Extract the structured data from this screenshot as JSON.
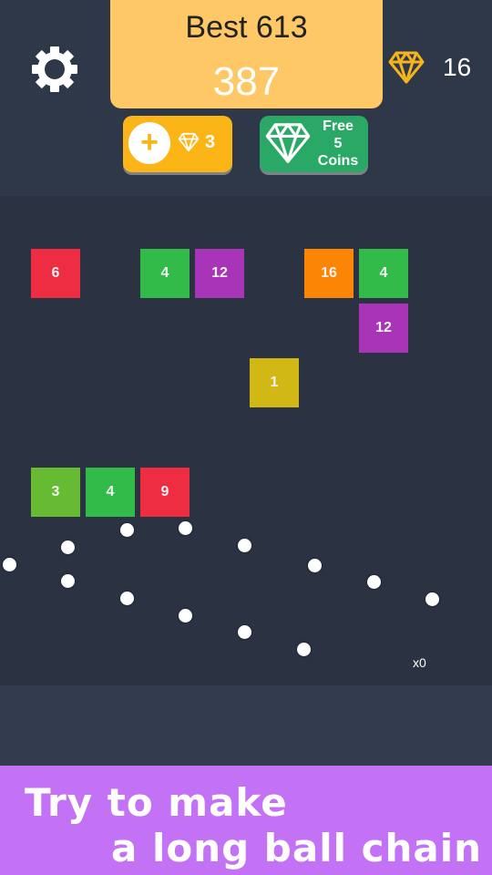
{
  "header": {
    "best_label": "Best 613",
    "score": "387",
    "gem_count": "16",
    "settings_icon": "gear-icon",
    "gem_icon": "diamond-icon"
  },
  "buttons": {
    "add_balls": {
      "icon": "plus-icon",
      "gem_icon": "diamond-icon",
      "cost": "3"
    },
    "free_coins": {
      "icon": "diamond-icon",
      "label_line1": "Free",
      "label_line2": "5",
      "label_line3": "Coins"
    }
  },
  "colors": {
    "score_card": "#fec866",
    "add_button": "#fbb516",
    "free_button": "#2aa865",
    "gem": "#f5b41d",
    "promo_banner": "#c372f5"
  },
  "board": {
    "blocks": [
      {
        "value": "6",
        "col": 0,
        "row": 0,
        "color": "#ee2d43"
      },
      {
        "value": "4",
        "col": 2,
        "row": 0,
        "color": "#33bb49"
      },
      {
        "value": "12",
        "col": 3,
        "row": 0,
        "color": "#a835b8"
      },
      {
        "value": "16",
        "col": 5,
        "row": 0,
        "color": "#fd8505"
      },
      {
        "value": "4",
        "col": 6,
        "row": 0,
        "color": "#33bb49"
      },
      {
        "value": "12",
        "col": 6,
        "row": 1,
        "color": "#a835b8"
      },
      {
        "value": "1",
        "col": 4,
        "row": 2,
        "color": "#d2b815"
      },
      {
        "value": "3",
        "col": 0,
        "row": 4,
        "color": "#66bb33"
      },
      {
        "value": "4",
        "col": 1,
        "row": 4,
        "color": "#33bb49"
      },
      {
        "value": "9",
        "col": 2,
        "row": 4,
        "color": "#ee2d43"
      }
    ],
    "ball_count": 13,
    "multiplier": "x0"
  },
  "promo": {
    "line1": "Try to make",
    "line2": "a long ball chain"
  }
}
